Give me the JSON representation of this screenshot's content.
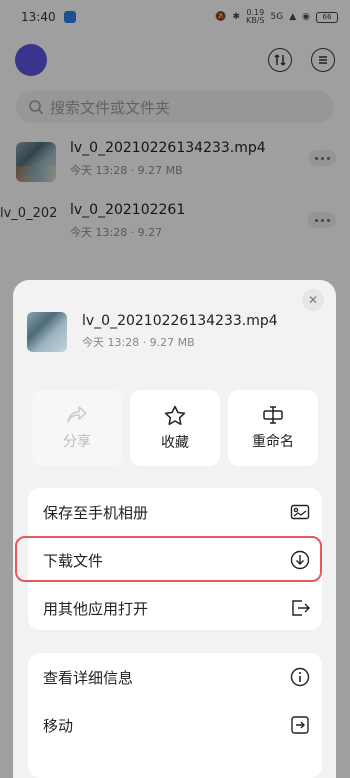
{
  "status_bar": {
    "time": "13:40",
    "speed": "0.19",
    "speed_unit": "KB/S",
    "network": "5G",
    "battery": "66"
  },
  "search": {
    "placeholder": "搜索文件或文件夹"
  },
  "files": [
    {
      "name": "lv_0_20210226134233.mp4",
      "meta": "今天 13:28 · 9.27 MB"
    },
    {
      "name": "lv_0_202102261",
      "meta": "今天 13:28 · 9.27",
      "thumb_alt": "lv_0_202"
    }
  ],
  "sheet": {
    "file_name": "lv_0_20210226134233.mp4",
    "file_meta": "今天 13:28 · 9.27 MB",
    "actions": [
      {
        "label": "分享",
        "icon": "share-icon",
        "enabled": false
      },
      {
        "label": "收藏",
        "icon": "star-icon",
        "enabled": true
      },
      {
        "label": "重命名",
        "icon": "rename-icon",
        "enabled": true
      }
    ],
    "menu_group_1": [
      {
        "label": "保存至手机相册",
        "icon": "album-icon"
      },
      {
        "label": "下载文件",
        "icon": "download-icon",
        "highlighted": true
      },
      {
        "label": "用其他应用打开",
        "icon": "open-external-icon"
      }
    ],
    "menu_group_2": [
      {
        "label": "查看详细信息",
        "icon": "info-icon"
      },
      {
        "label": "移动",
        "icon": "move-icon"
      }
    ]
  },
  "colors": {
    "avatar": "#5a50d8",
    "highlight": "#e25b5b"
  }
}
